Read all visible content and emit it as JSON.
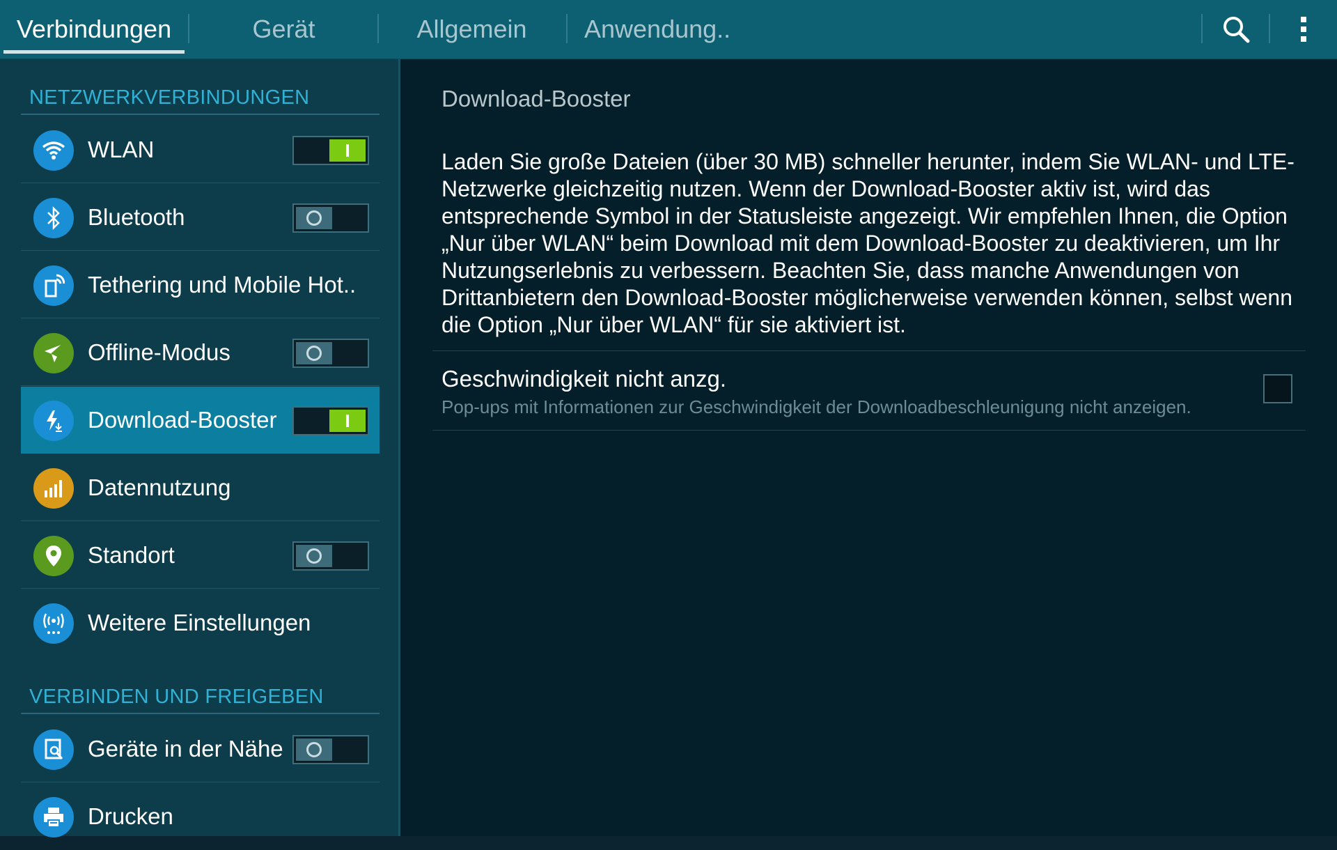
{
  "tabs": [
    {
      "label": "Verbindungen",
      "active": true
    },
    {
      "label": "Gerät",
      "active": false
    },
    {
      "label": "Allgemein",
      "active": false
    },
    {
      "label": "Anwendung..",
      "active": false
    }
  ],
  "topbar": {
    "search_icon": "search-icon",
    "menu_icon": "more-vert-icon"
  },
  "sections": {
    "network": "NETZWERKVERBINDUNGEN",
    "connect": "VERBINDEN UND FREIGEBEN"
  },
  "items": [
    {
      "label": "WLAN",
      "icon": "wifi-icon",
      "color": "#1a8fd6",
      "toggle": "on"
    },
    {
      "label": "Bluetooth",
      "icon": "bluetooth-icon",
      "color": "#1a8fd6",
      "toggle": "off"
    },
    {
      "label": "Tethering und Mobile Hot..",
      "icon": "tethering-icon",
      "color": "#1a8fd6",
      "toggle": null
    },
    {
      "label": "Offline-Modus",
      "icon": "airplane-icon",
      "color": "#5a9a1e",
      "toggle": "off"
    },
    {
      "label": "Download-Booster",
      "icon": "download-booster-icon",
      "color": "#1a8fd6",
      "toggle": "on",
      "selected": true
    },
    {
      "label": "Datennutzung",
      "icon": "data-usage-icon",
      "color": "#d99a19",
      "toggle": null
    },
    {
      "label": "Standort",
      "icon": "location-icon",
      "color": "#5a9a1e",
      "toggle": "off"
    },
    {
      "label": "Weitere Einstellungen",
      "icon": "more-networks-icon",
      "color": "#1a8fd6",
      "toggle": null
    },
    {
      "label": "Geräte in der Nähe",
      "icon": "nearby-devices-icon",
      "color": "#1a8fd6",
      "toggle": "off"
    },
    {
      "label": "Drucken",
      "icon": "printer-icon",
      "color": "#1a8fd6",
      "toggle": null
    }
  ],
  "detail": {
    "title": "Download-Booster",
    "description": "Laden Sie große Dateien (über 30 MB) schneller herunter, indem Sie WLAN- und LTE-Netzwerke gleichzeitig nutzen. Wenn der Download-Booster aktiv ist, wird das entsprechende Symbol in der Statusleiste angezeigt. Wir empfehlen Ihnen, die Option „Nur über WLAN“ beim Download mit dem Download-Booster zu deaktivieren, um Ihr Nutzungserlebnis zu verbessern. Beachten Sie, dass manche Anwendungen von Drittanbietern den Download-Booster möglicherweise verwenden können, selbst wenn die Option „Nur über WLAN“ für sie aktiviert ist.",
    "option_title": "Geschwindigkeit nicht anzg.",
    "option_subtitle": "Pop-ups mit Informationen zur Geschwindigkeit der Downloadbeschleunigung nicht anzeigen.",
    "option_checked": false
  },
  "colors": {
    "accent": "#2fb2d6",
    "toggle_on": "#7ccb13",
    "topbar": "#0d5f72",
    "selected": "#0c7fa0"
  }
}
